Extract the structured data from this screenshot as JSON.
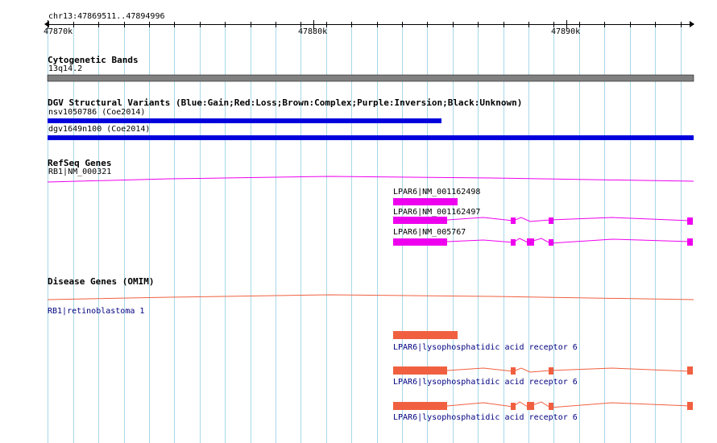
{
  "ruler": {
    "location": "chr13:47869511..47894996",
    "start": 47869511,
    "end": 47894996,
    "ticks": [
      {
        "pos": 47870000,
        "label": "47870k"
      },
      {
        "pos": 47880000,
        "label": "47880k"
      },
      {
        "pos": 47890000,
        "label": "47890k"
      }
    ]
  },
  "tracks": {
    "cytoband": {
      "title": "Cytogenetic Bands",
      "band": {
        "label": "13q14.2",
        "color": "#808080"
      }
    },
    "dgv": {
      "title": "DGV Structural Variants (Blue:Gain;Red:Loss;Brown:Complex;Purple:Inversion;Black:Unknown)",
      "color": "#0000dd",
      "features": [
        {
          "label": "nsv1050786 (Coe2014)"
        },
        {
          "label": "dgv1649n100 (Coe2014)"
        }
      ]
    },
    "refseq": {
      "title": "RefSeq Genes",
      "color": "#ee00ee",
      "genes": [
        {
          "label": "RB1|NM_000321"
        },
        {
          "label": "LPAR6|NM_001162498"
        },
        {
          "label": "LPAR6|NM_001162497"
        },
        {
          "label": "LPAR6|NM_005767"
        }
      ]
    },
    "omim": {
      "title": "Disease Genes (OMIM)",
      "color": "#f06040",
      "genes": [
        {
          "label": "RB1|retinoblastoma 1"
        },
        {
          "label": "LPAR6|lysophosphatidic acid receptor 6"
        },
        {
          "label": "LPAR6|lysophosphatidic acid receptor 6"
        },
        {
          "label": "LPAR6|lysophosphatidic acid receptor 6"
        }
      ]
    }
  },
  "colors": {
    "grid": "#a8d8e8",
    "background": "#ffffff"
  }
}
